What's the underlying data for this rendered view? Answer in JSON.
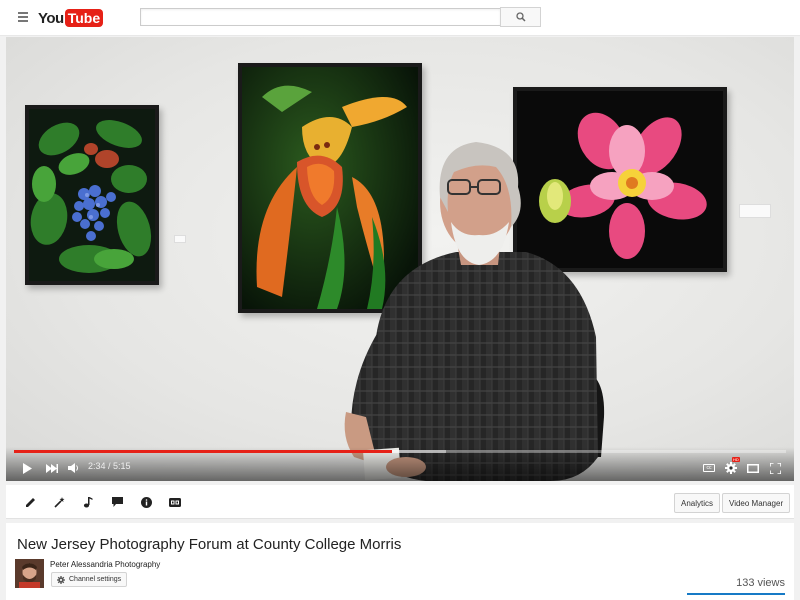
{
  "masthead": {
    "logo_you": "You",
    "logo_tube": "Tube",
    "search_placeholder": ""
  },
  "player": {
    "current_time": "2:34",
    "separator": " / ",
    "duration": "5:15",
    "progress_fraction": 0.489,
    "loaded_fraction": 0.56,
    "hd_badge": "HD",
    "cc_label": "cc"
  },
  "actionbar": {
    "analytics_label": "Analytics",
    "video_manager_label": "Video Manager"
  },
  "video": {
    "title": "New Jersey Photography Forum at County College Morris",
    "channel_name": "Peter Alessandria Photography",
    "channel_settings_label": "Channel settings",
    "views": "133 views"
  },
  "colors": {
    "brand_red": "#e62117",
    "link_blue": "#167ac6"
  }
}
